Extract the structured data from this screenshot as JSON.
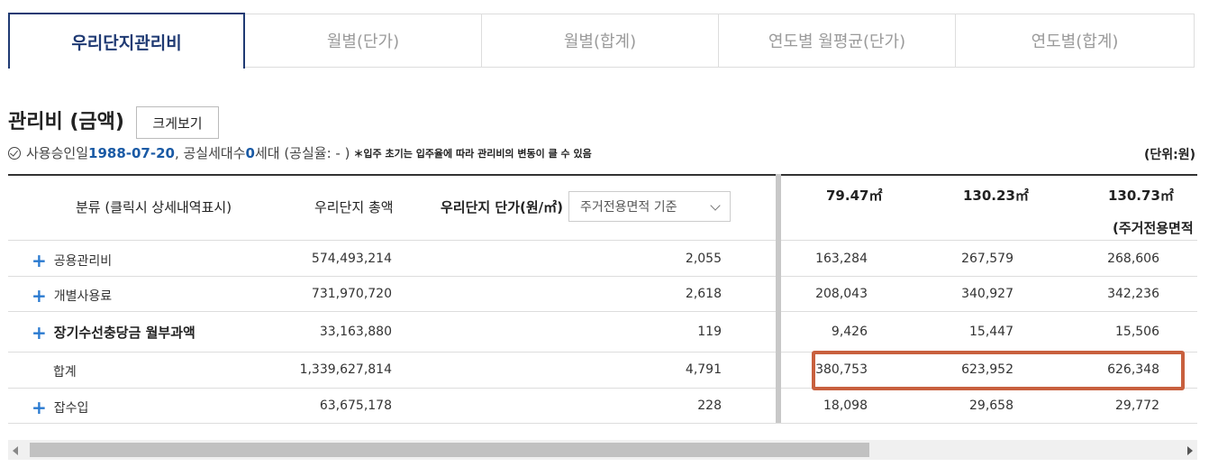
{
  "tabs": [
    {
      "label": "우리단지관리비",
      "active": true
    },
    {
      "label": "월별(단가)",
      "active": false
    },
    {
      "label": "월별(합계)",
      "active": false
    },
    {
      "label": "연도별 월평균(단가)",
      "active": false
    },
    {
      "label": "연도별(합계)",
      "active": false
    }
  ],
  "section": {
    "title": "관리비 (금액)",
    "zoom_button": "크게보기",
    "info_prefix": "사용승인일 ",
    "approval_date": "1988-07-20",
    "info_middle": ", 공실세대수 ",
    "vacant_count": "0",
    "info_suffix": "세대 (공실율: - )",
    "note": "＊입주 초기는 입주율에 따라 관리비의 변동이 클 수 있음",
    "unit": "(단위:원)"
  },
  "table": {
    "headers": {
      "category": "분류 (클릭시 상세내역표시)",
      "total": "우리단지 총액",
      "unit_price": "우리단지 단가(원/㎡)",
      "basis_select": "주거전용면적 기준",
      "area1": "79.47㎡",
      "area2": "130.23㎡",
      "area3": "130.73㎡",
      "area3_sub": "(주거전용면적"
    },
    "rows": [
      {
        "label": "공용관리비",
        "total": "574,493,214",
        "unit": "2,055",
        "a1": "163,284",
        "a2": "267,579",
        "a3": "268,606"
      },
      {
        "label": "개별사용료",
        "total": "731,970,720",
        "unit": "2,618",
        "a1": "208,043",
        "a2": "340,927",
        "a3": "342,236"
      },
      {
        "label": "장기수선충당금 월부과액",
        "total": "33,163,880",
        "unit": "119",
        "a1": "9,426",
        "a2": "15,447",
        "a3": "15,506"
      },
      {
        "label": "합계",
        "total": "1,339,627,814",
        "unit": "4,791",
        "a1": "380,753",
        "a2": "623,952",
        "a3": "626,348"
      },
      {
        "label": "잡수입",
        "total": "63,675,178",
        "unit": "228",
        "a1": "18,098",
        "a2": "29,658",
        "a3": "29,772"
      }
    ]
  },
  "colors": {
    "accent": "#1f3a73",
    "plus": "#2a7ad0",
    "highlight": "#c8603e"
  },
  "icons": [
    "check-circle-icon",
    "plus-icon",
    "chevron-down-icon",
    "scroll-left-icon",
    "scroll-right-icon"
  ]
}
